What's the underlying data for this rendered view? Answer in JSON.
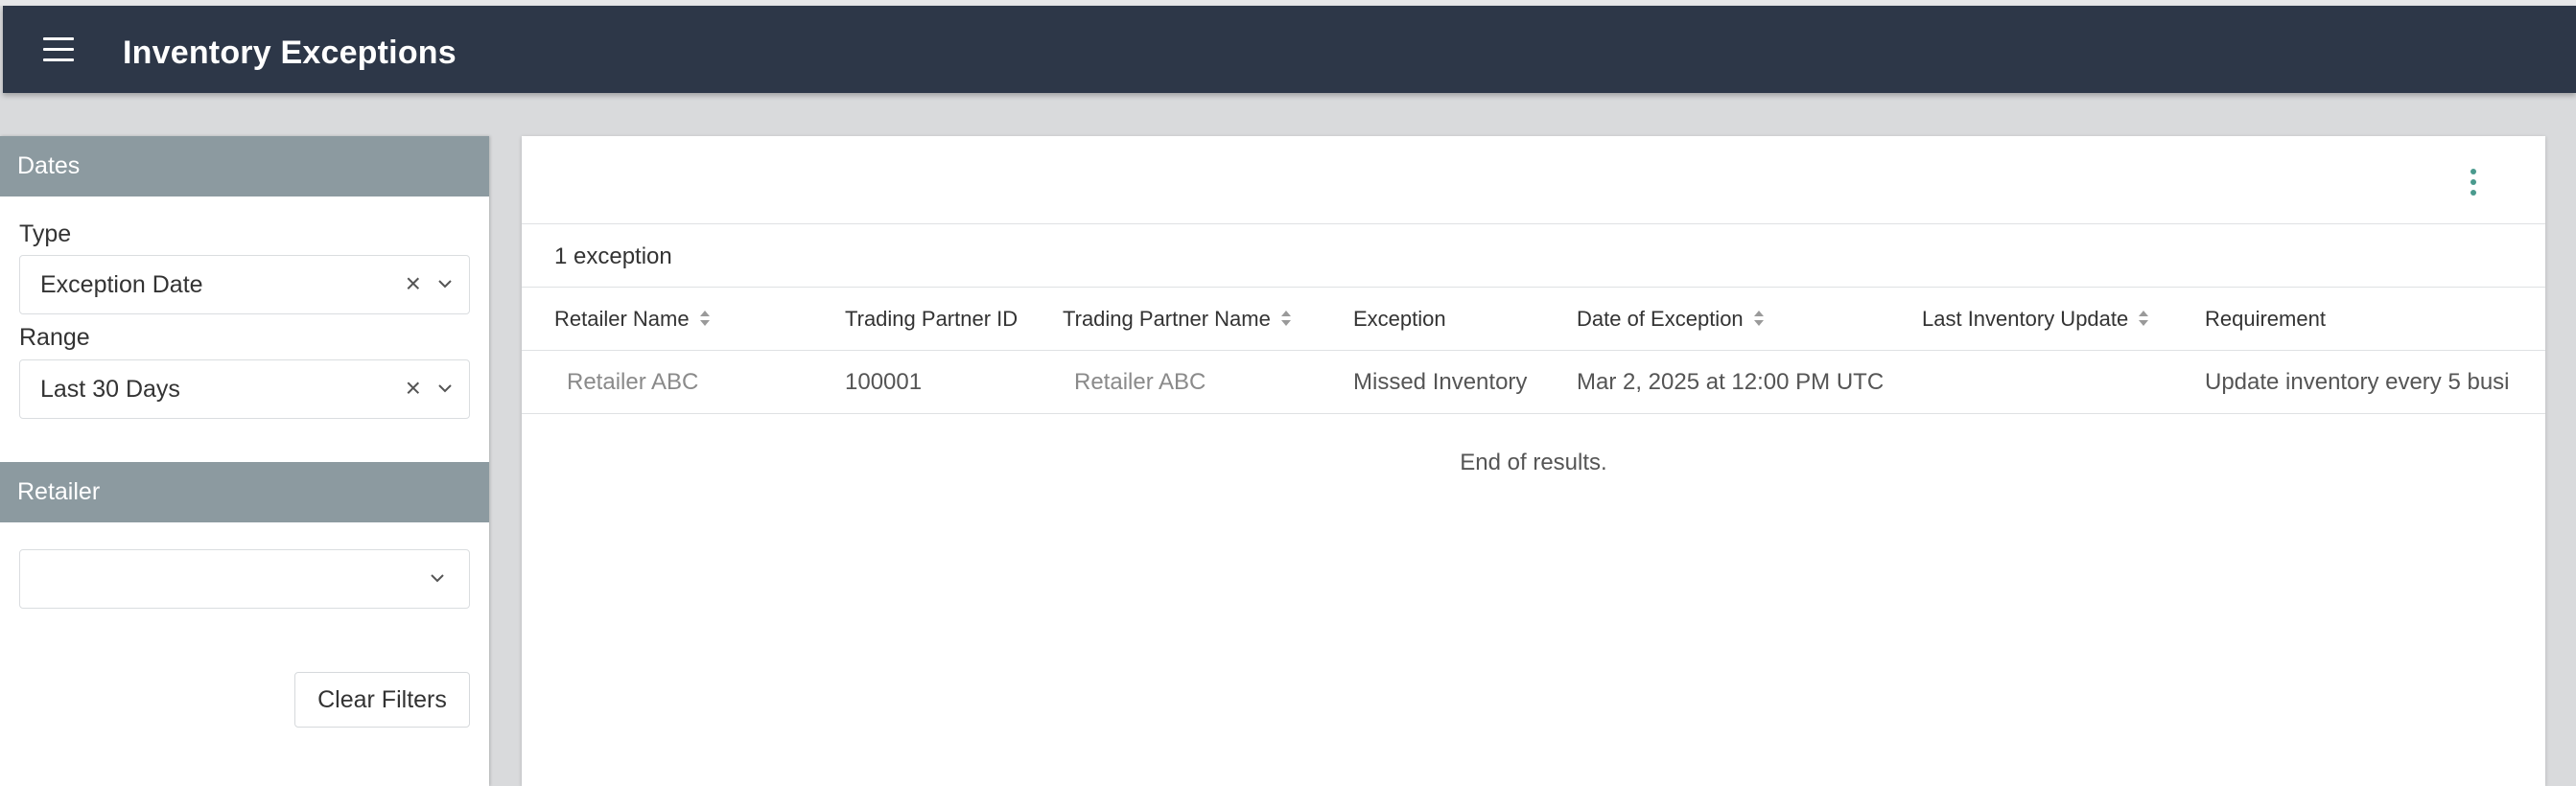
{
  "header": {
    "title": "Inventory Exceptions",
    "menu_icon": "hamburger-menu-icon"
  },
  "sidebar": {
    "dates": {
      "heading": "Dates",
      "type_label": "Type",
      "type_value": "Exception Date",
      "range_label": "Range",
      "range_value": "Last 30 Days"
    },
    "retailer": {
      "heading": "Retailer",
      "value": ""
    },
    "clear_filters_label": "Clear Filters"
  },
  "main": {
    "exception_count": "1 exception",
    "columns": [
      {
        "label": "Retailer Name",
        "sortable": true
      },
      {
        "label": "Trading Partner ID",
        "sortable": false
      },
      {
        "label": "Trading Partner Name",
        "sortable": true
      },
      {
        "label": "Exception",
        "sortable": false
      },
      {
        "label": "Date of Exception",
        "sortable": true
      },
      {
        "label": "Last Inventory Update",
        "sortable": true
      },
      {
        "label": "Requirement",
        "sortable": false
      }
    ],
    "rows": [
      {
        "retailer_name": "Retailer ABC",
        "trading_partner_id": "100001",
        "trading_partner_name": "Retailer ABC",
        "exception": "Missed Inventory",
        "date_of_exception": "Mar 2, 2025 at 12:00 PM UTC",
        "last_inventory_update": "",
        "requirement": "Update inventory every 5 busi"
      }
    ],
    "end_of_results": "End of results."
  },
  "colors": {
    "header_bg": "#2d3748",
    "section_head_bg": "#8c9aa0",
    "kebab": "#4a9a8e"
  }
}
